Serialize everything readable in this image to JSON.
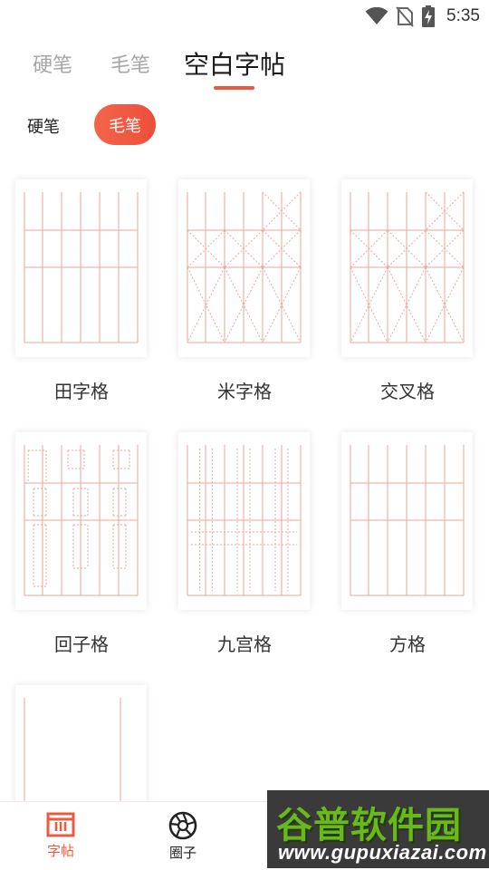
{
  "status_bar": {
    "time": "5:35",
    "icons": [
      "wifi-icon",
      "no-sim-icon",
      "battery-charging-icon"
    ]
  },
  "tabs": [
    {
      "label": "硬笔",
      "active": false
    },
    {
      "label": "毛笔",
      "active": false
    },
    {
      "label": "空白字帖",
      "active": true
    }
  ],
  "subtabs": [
    {
      "label": "硬笔",
      "active": false
    },
    {
      "label": "毛笔",
      "active": true
    }
  ],
  "grid_styles": [
    {
      "label": "田字格",
      "pattern": "tian"
    },
    {
      "label": "米字格",
      "pattern": "mi"
    },
    {
      "label": "交叉格",
      "pattern": "jiaocha"
    },
    {
      "label": "回子格",
      "pattern": "huizi"
    },
    {
      "label": "九宫格",
      "pattern": "jiugong"
    },
    {
      "label": "方格",
      "pattern": "fang"
    },
    {
      "label": "",
      "pattern": "lines"
    }
  ],
  "bottom_nav": [
    {
      "label": "字帖",
      "icon": "copybook-icon",
      "active": true
    },
    {
      "label": "圈子",
      "icon": "aperture-icon",
      "active": false
    }
  ],
  "watermark": {
    "title": "谷普软件园",
    "url": "www.gupuxiazai.com"
  },
  "colors": {
    "accent": "#ec5a3e",
    "grid_line": "#e9a79b"
  }
}
